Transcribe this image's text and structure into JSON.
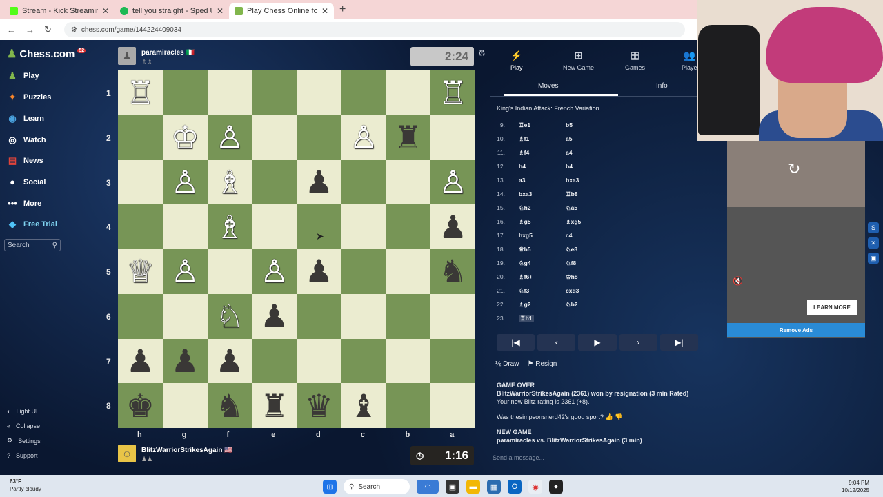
{
  "browser": {
    "tabs": [
      {
        "title": "Stream - Kick Streaming",
        "color": "#53fc18"
      },
      {
        "title": "tell you straight - Sped Up",
        "color": "#1db954"
      },
      {
        "title": "Play Chess Online for FREE",
        "color": "#81b64c"
      }
    ],
    "url": "chess.com/game/144224409034"
  },
  "sidebar": {
    "logo": "Chess.com",
    "badge": "52",
    "items": [
      {
        "label": "Play",
        "icon": "pawn-icon"
      },
      {
        "label": "Puzzles",
        "icon": "puzzle-icon"
      },
      {
        "label": "Learn",
        "icon": "learn-icon"
      },
      {
        "label": "Watch",
        "icon": "watch-icon"
      },
      {
        "label": "News",
        "icon": "news-icon"
      },
      {
        "label": "Social",
        "icon": "social-icon"
      },
      {
        "label": "More",
        "icon": "more-icon"
      },
      {
        "label": "Free Trial",
        "icon": "diamond-icon"
      }
    ],
    "search_placeholder": "Search",
    "footer": [
      "Light UI",
      "Collapse",
      "Settings",
      "Support"
    ]
  },
  "game": {
    "top_player": {
      "name": "paramiracles",
      "flag": "🇮🇹",
      "clock": "2:24"
    },
    "bottom_player": {
      "name": "BlitzWarriorStrikesAgain",
      "flag": "🇺🇸",
      "clock": "1:16"
    },
    "ranks": [
      "1",
      "2",
      "3",
      "4",
      "5",
      "6",
      "7",
      "8"
    ],
    "files": [
      "h",
      "g",
      "f",
      "e",
      "d",
      "c",
      "b",
      "a"
    ],
    "board": [
      [
        "wR",
        "",
        "",
        "",
        "",
        "",
        "",
        "wR"
      ],
      [
        "",
        "wK",
        "wP",
        "",
        "",
        "wP",
        "bR",
        ""
      ],
      [
        "",
        "wP",
        "wB",
        "",
        "bP",
        "",
        "",
        "wP"
      ],
      [
        "",
        "",
        "wB",
        "",
        "",
        "",
        "",
        "bP"
      ],
      [
        "wQ",
        "wP",
        "",
        "wP",
        "bP",
        "",
        "",
        "bN"
      ],
      [
        "",
        "",
        "wN",
        "bP",
        "",
        "",
        "",
        ""
      ],
      [
        "bP",
        "bP",
        "bP",
        "",
        "",
        "",
        "",
        ""
      ],
      [
        "bK",
        "",
        "bN",
        "bR",
        "bQ",
        "bB",
        "",
        ""
      ]
    ]
  },
  "panel": {
    "tabs": [
      "Play",
      "New Game",
      "Games",
      "Playe"
    ],
    "subtabs": [
      "Moves",
      "Info"
    ],
    "opening": "King's Indian Attack: French Variation",
    "moves": [
      {
        "n": "9.",
        "w": "♖e1",
        "b": "b5"
      },
      {
        "n": "10.",
        "w": "♗f1",
        "b": "a5"
      },
      {
        "n": "11.",
        "w": "♗f4",
        "b": "a4"
      },
      {
        "n": "12.",
        "w": "h4",
        "b": "b4"
      },
      {
        "n": "13.",
        "w": "a3",
        "b": "bxa3"
      },
      {
        "n": "14.",
        "w": "bxa3",
        "b": "♖b8"
      },
      {
        "n": "15.",
        "w": "♘h2",
        "b": "♘a5"
      },
      {
        "n": "16.",
        "w": "♗g5",
        "b": "♗xg5"
      },
      {
        "n": "17.",
        "w": "hxg5",
        "b": "c4"
      },
      {
        "n": "18.",
        "w": "♕h5",
        "b": "♘e8"
      },
      {
        "n": "19.",
        "w": "♘g4",
        "b": "♘f8"
      },
      {
        "n": "20.",
        "w": "♗f6+",
        "b": "♔h8"
      },
      {
        "n": "21.",
        "w": "♘f3",
        "b": "cxd3"
      },
      {
        "n": "22.",
        "w": "♗g2",
        "b": "♘b2"
      },
      {
        "n": "23.",
        "w": "♖h1",
        "b": ""
      }
    ],
    "actions": {
      "draw": "Draw",
      "resign": "Resign"
    },
    "chat": {
      "over_title": "GAME OVER",
      "over_line1": "BlitzWarriorStrikesAgain (2361) won by resignation (3 min Rated)",
      "over_line2": "Your new Blitz rating is 2361 (+8).",
      "sport": "Was thesimpsonsnerd42's good sport?",
      "new_title": "NEW GAME",
      "new_line": "paramiracles vs. BlitzWarriorStrikesAgain (3 min)",
      "placeholder": "Send a message..."
    }
  },
  "ad": {
    "learn_more": "LEARN MORE",
    "remove_ads": "Remove Ads"
  },
  "taskbar": {
    "temp": "63°F",
    "weather": "Partly cloudy",
    "search": "Search",
    "time": "9:04 PM",
    "date": "10/12/2025"
  }
}
